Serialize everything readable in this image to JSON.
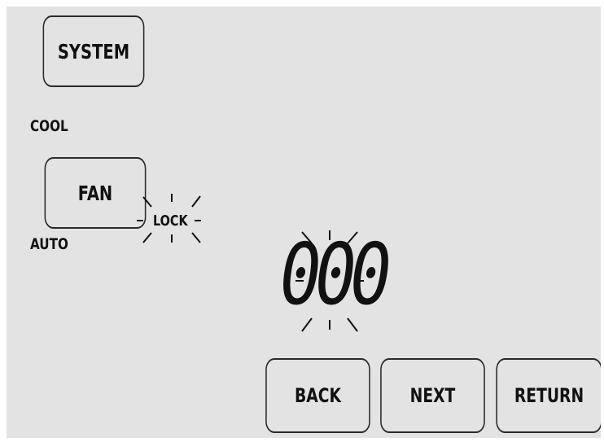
{
  "system": {
    "button_label": "SYSTEM",
    "mode": "COOL"
  },
  "fan": {
    "button_label": "FAN",
    "mode": "AUTO"
  },
  "lock": {
    "label": "LOCK"
  },
  "display": {
    "digits": "000"
  },
  "nav": {
    "back_label": "BACK",
    "next_label": "NEXT",
    "return_label": "RETURN"
  }
}
